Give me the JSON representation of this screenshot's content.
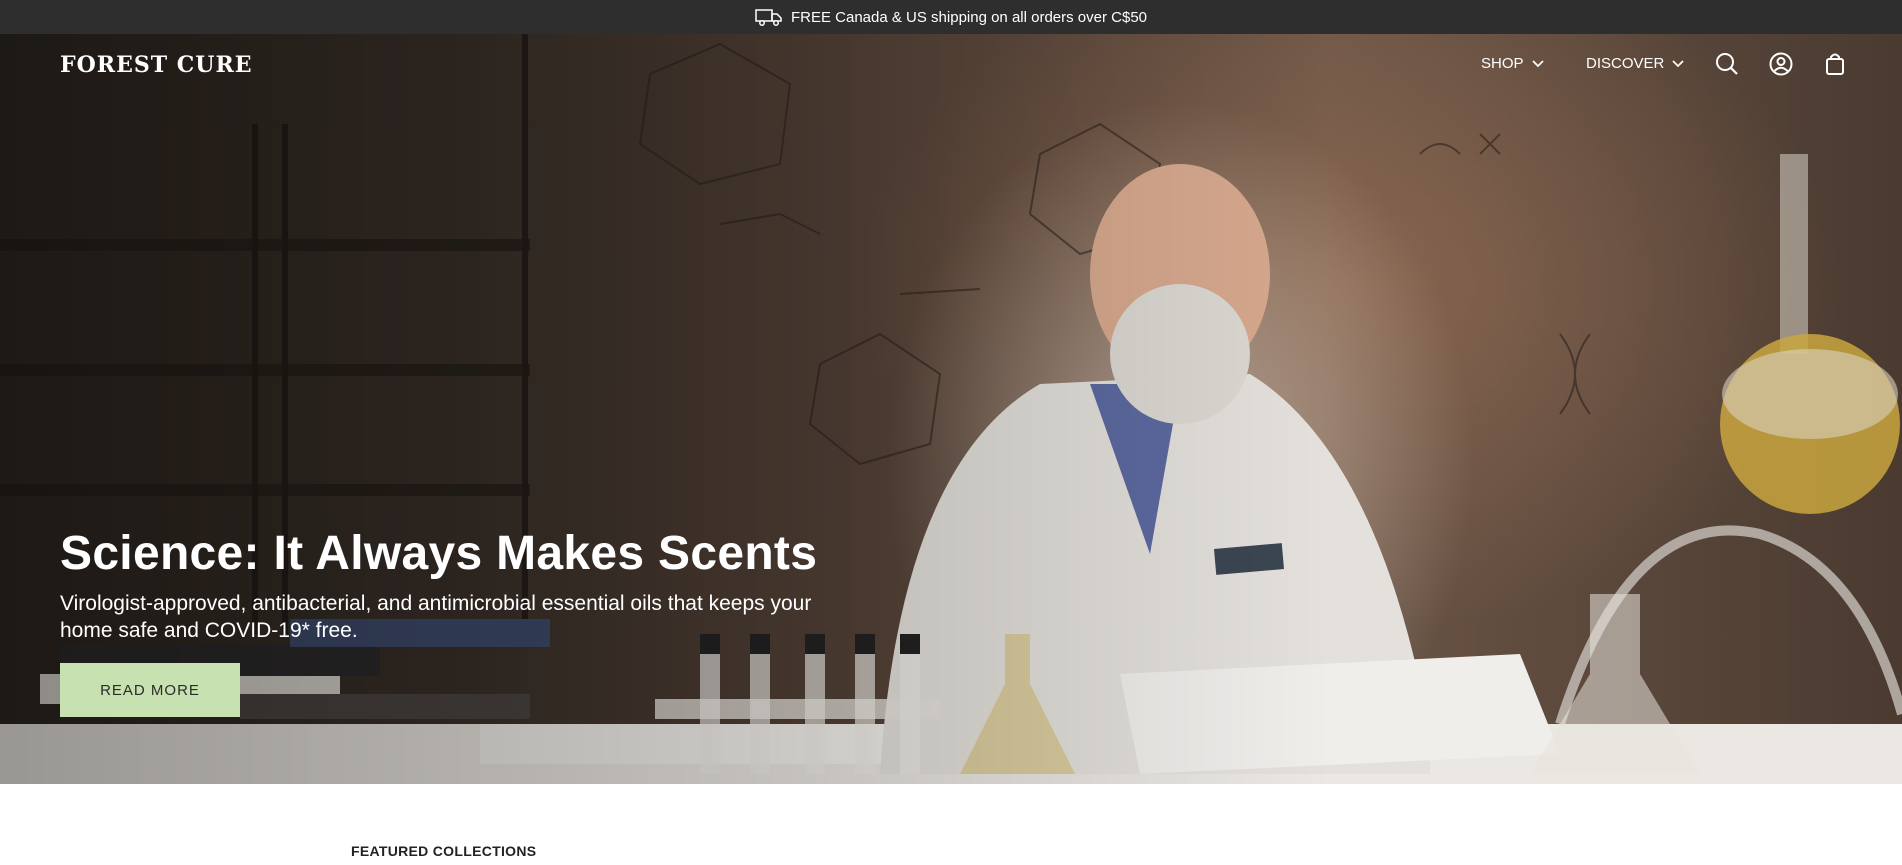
{
  "announcement": {
    "text": "FREE Canada & US shipping on all orders over C$50",
    "icon": "truck-icon"
  },
  "header": {
    "logo": "FOREST CURE",
    "nav": [
      {
        "label": "SHOP",
        "icon": "chevron-down-icon"
      },
      {
        "label": "DISCOVER",
        "icon": "chevron-down-icon"
      }
    ],
    "icons": [
      "search-icon",
      "account-icon",
      "cart-icon"
    ]
  },
  "hero": {
    "title": "Science: It Always Makes Scents",
    "subtitle": "Virologist-approved, antibacterial, and antimicrobial essential oils that keeps your home safe and COVID-19* free.",
    "button_label": "READ MORE",
    "button_color": "#c7e2b0"
  },
  "featured": {
    "heading": "FEATURED COLLECTIONS"
  },
  "colors": {
    "announcement_bg": "#2e2e2e",
    "text_light": "#ffffff"
  }
}
